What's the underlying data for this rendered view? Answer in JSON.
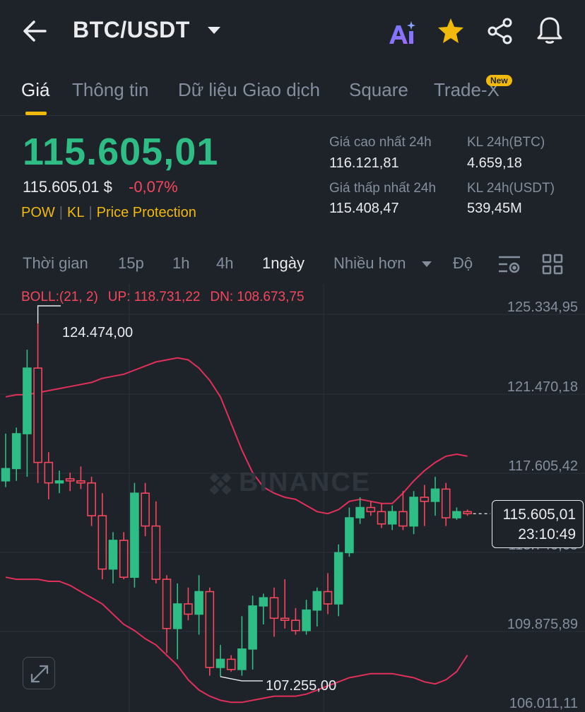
{
  "header": {
    "pair": "BTC/USDT",
    "icons": [
      "back-arrow-icon",
      "ai-icon",
      "star-icon",
      "share-icon",
      "bell-icon"
    ]
  },
  "tabs": [
    {
      "label": "Giá",
      "active": true
    },
    {
      "label": "Thông tin"
    },
    {
      "label": "Dữ liệu Giao dịch"
    },
    {
      "label": "Square"
    },
    {
      "label": "Trade-X",
      "badge": "New"
    }
  ],
  "price": {
    "last": "115.605,01",
    "usd": "115.605,01 $",
    "change": "-0,07%",
    "tags": [
      "POW",
      "KL",
      "Price Protection"
    ]
  },
  "stats": {
    "high_label": "Giá cao nhất 24h",
    "high_value": "116.121,81",
    "low_label": "Giá thấp nhất 24h",
    "low_value": "115.408,47",
    "vol_btc_label": "KL 24h(BTC)",
    "vol_btc_value": "4.659,18",
    "vol_usdt_label": "KL 24h(USDT)",
    "vol_usdt_value": "539,45M"
  },
  "intervals": {
    "items": [
      "Thời gian",
      "15p",
      "1h",
      "4h",
      "1ngày",
      "Nhiều hơn",
      "Độ"
    ],
    "active": "1ngày"
  },
  "chart": {
    "boll_label": "BOLL:(21, 2)",
    "boll_up": "UP: 118.731,22",
    "boll_dn": "DN: 108.673,75",
    "y_axis": [
      "125.334,95",
      "121.470,18",
      "117.605,42",
      "113.740,65",
      "109.875,89",
      "106.011,11"
    ],
    "high_marker": "124.474,00",
    "low_marker": "107.255,00",
    "current_price": "115.605,01",
    "countdown": "23:10:49",
    "watermark": "BINANCE",
    "colors": {
      "up": "#2ebd85",
      "down": "#f6465d",
      "boll": "#e0305a",
      "background": "#1e2329"
    }
  },
  "chart_data": {
    "type": "candlestick",
    "y_axis_range": [
      106011.11,
      125334.95
    ],
    "candles": [
      {
        "o": 116800,
        "h": 119100,
        "l": 116500,
        "c": 117400
      },
      {
        "o": 117400,
        "h": 119400,
        "l": 116800,
        "c": 119100
      },
      {
        "o": 119100,
        "h": 123200,
        "l": 117000,
        "c": 122300
      },
      {
        "o": 122300,
        "h": 124474,
        "l": 116700,
        "c": 117700
      },
      {
        "o": 117700,
        "h": 118200,
        "l": 115900,
        "c": 116700
      },
      {
        "o": 116700,
        "h": 117300,
        "l": 116200,
        "c": 116800
      },
      {
        "o": 116900,
        "h": 117200,
        "l": 116300,
        "c": 116800
      },
      {
        "o": 116800,
        "h": 117500,
        "l": 116400,
        "c": 116700
      },
      {
        "o": 116700,
        "h": 117000,
        "l": 114600,
        "c": 115100
      },
      {
        "o": 115100,
        "h": 116200,
        "l": 112000,
        "c": 112500
      },
      {
        "o": 112500,
        "h": 114300,
        "l": 111800,
        "c": 113900
      },
      {
        "o": 113900,
        "h": 114300,
        "l": 112000,
        "c": 112100
      },
      {
        "o": 112100,
        "h": 116700,
        "l": 111600,
        "c": 116200
      },
      {
        "o": 116200,
        "h": 116700,
        "l": 114100,
        "c": 114600
      },
      {
        "o": 114600,
        "h": 115800,
        "l": 111800,
        "c": 112000
      },
      {
        "o": 112000,
        "h": 112200,
        "l": 108400,
        "c": 109600
      },
      {
        "o": 109600,
        "h": 111800,
        "l": 108100,
        "c": 110800
      },
      {
        "o": 110800,
        "h": 111600,
        "l": 110000,
        "c": 110300
      },
      {
        "o": 110300,
        "h": 112200,
        "l": 109300,
        "c": 111400
      },
      {
        "o": 111400,
        "h": 111600,
        "l": 107300,
        "c": 107700
      },
      {
        "o": 107700,
        "h": 108800,
        "l": 107255,
        "c": 108100
      },
      {
        "o": 108100,
        "h": 108300,
        "l": 107500,
        "c": 107600
      },
      {
        "o": 107600,
        "h": 110200,
        "l": 107300,
        "c": 108600
      },
      {
        "o": 108600,
        "h": 111200,
        "l": 107600,
        "c": 110700
      },
      {
        "o": 110700,
        "h": 111300,
        "l": 109800,
        "c": 111100
      },
      {
        "o": 111100,
        "h": 111600,
        "l": 109200,
        "c": 110100
      },
      {
        "o": 110100,
        "h": 112000,
        "l": 109600,
        "c": 110000
      },
      {
        "o": 110000,
        "h": 110600,
        "l": 109300,
        "c": 109500
      },
      {
        "o": 109500,
        "h": 111000,
        "l": 109300,
        "c": 110500
      },
      {
        "o": 110500,
        "h": 111600,
        "l": 109700,
        "c": 111400
      },
      {
        "o": 111400,
        "h": 112300,
        "l": 110300,
        "c": 110800
      },
      {
        "o": 110800,
        "h": 113700,
        "l": 110200,
        "c": 113300
      },
      {
        "o": 113300,
        "h": 115500,
        "l": 113100,
        "c": 115000
      },
      {
        "o": 115000,
        "h": 116000,
        "l": 114700,
        "c": 115500
      },
      {
        "o": 115500,
        "h": 115800,
        "l": 115100,
        "c": 115300
      },
      {
        "o": 115300,
        "h": 115700,
        "l": 114500,
        "c": 114700
      },
      {
        "o": 114700,
        "h": 115600,
        "l": 114400,
        "c": 115300
      },
      {
        "o": 115300,
        "h": 116300,
        "l": 114400,
        "c": 114600
      },
      {
        "o": 114600,
        "h": 116300,
        "l": 114200,
        "c": 116000
      },
      {
        "o": 116000,
        "h": 116600,
        "l": 114600,
        "c": 115800
      },
      {
        "o": 115800,
        "h": 117000,
        "l": 115100,
        "c": 116400
      },
      {
        "o": 116400,
        "h": 116700,
        "l": 114600,
        "c": 115000
      },
      {
        "o": 115000,
        "h": 115500,
        "l": 114900,
        "c": 115300
      },
      {
        "o": 115300,
        "h": 115400,
        "l": 115100,
        "c": 115200
      }
    ],
    "boll_upper": [
      120900,
      121000,
      121000,
      121100,
      121200,
      121300,
      121400,
      121500,
      121600,
      121800,
      121900,
      122000,
      122200,
      122400,
      122600,
      122700,
      122800,
      122700,
      122300,
      121700,
      120900,
      119600,
      118300,
      117200,
      116500,
      116200,
      116000,
      115900,
      115600,
      115300,
      115200,
      115400,
      115800,
      115900,
      115800,
      115700,
      115700,
      116200,
      116800,
      117300,
      117700,
      118000,
      118100,
      118000
    ],
    "boll_lower": [
      112100,
      112000,
      112000,
      112000,
      111900,
      111900,
      111700,
      111400,
      111100,
      110800,
      110300,
      109800,
      109500,
      109100,
      108800,
      108300,
      107800,
      107100,
      106600,
      106300,
      106100,
      106000,
      106000,
      106100,
      106200,
      106300,
      106300,
      106300,
      106400,
      106600,
      106800,
      107000,
      107200,
      107300,
      107400,
      107400,
      107400,
      107300,
      107200,
      107000,
      106900,
      107100,
      107500,
      108300
    ]
  }
}
